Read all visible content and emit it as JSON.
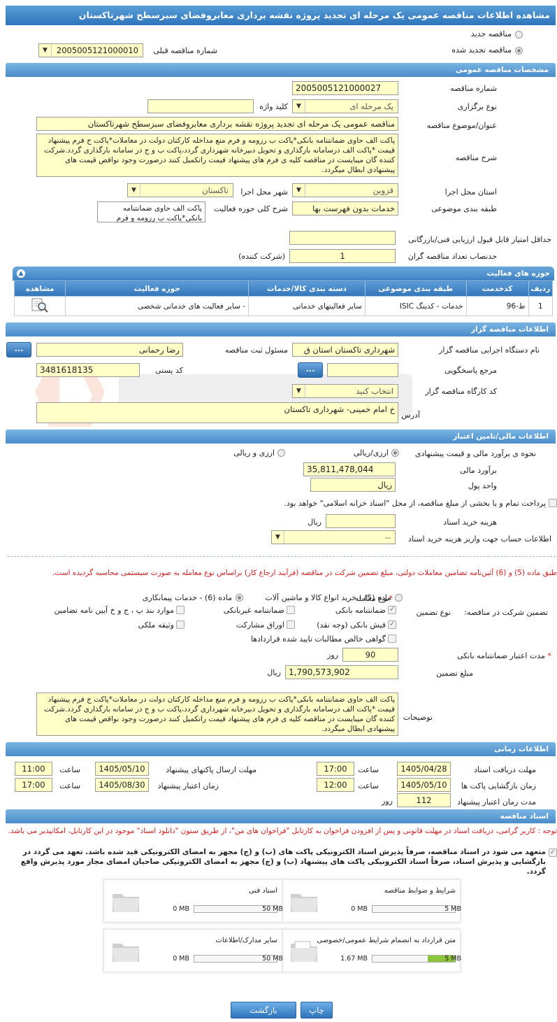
{
  "page_title": "مشاهده اطلاعات مناقصه عمومی یک مرحله ای تجدید پروژه نقشه برداری معابروفضای سبزسطح شهرتاکستان",
  "top": {
    "new_tender": "مناقصه جدید",
    "renewed_tender": "مناقصه تجدید شده",
    "prev_number_label": "شماره مناقصه قبلی",
    "prev_number": "2005005121000010"
  },
  "general": {
    "header": "مشخصات مناقصه عمومی",
    "number_label": "شماره مناقصه",
    "number": "2005005121000027",
    "type_label": "نوع برگزاری",
    "type": "یک مرحله ای",
    "keyword_label": "کلید واژه",
    "keyword": "",
    "subject_label": "عنوان/موضوع مناقصه",
    "subject": "مناقصه عمومی یک مرحله ای  تجدید پروژه نقشه برداری معابروفضای سبزسطح شهرتاکستان",
    "desc_label": "شرح مناقصه",
    "desc": "پاکت الف حاوی ضمانتنامه بانکی*پاکت ب رزومه و فرم منع مداخله کارکنان دولت در معاملات*پاکت ج فرم پیشنهاد  قیمت *پاکت الف درسامانه بارگذاری و تحویل دبیرخانه شهرداری گردد،پاکت ب و ج در سامانه بارگذاری گردد.شرکت کننده گان میبایست در مناقصه کلیه ی فرم های پیشنهاد قیمت راتکمیل کنند درصورت وجود نواقص قیمت های پیشنهادی ابطال میگردد.",
    "province_label": "استان محل اجرا",
    "province": "قزوین",
    "city_label": "شهر محل اجرا",
    "city": "تاکستان",
    "category_label": "طبقه بندی موضوعی",
    "category": "خدمات بدون فهرست بها",
    "activity_label": "شرح کلی حوزه فعالیت",
    "activity": "پاکت الف حاوی ضمانتنامه بانکی*پاکت ب رزومه و فرم",
    "min_score_label": "حداقل امتیاز قابل قبول ارزیابی فنی/بازرگانی",
    "min_score": "",
    "quorum_label": "حدنصاب تعداد مناقصه گران",
    "quorum": "1",
    "quorum_unit": "(شرکت کننده)"
  },
  "activity_grid": {
    "header": "حوزه های فعالیت",
    "columns": [
      "ردیف",
      "کدخدمت",
      "طبقه بندی موضوعی",
      "دسته بندی کالا/خدمات",
      "حوزه فعالیت",
      "مشاهده"
    ],
    "rows": [
      [
        "1",
        "ط-96",
        "خدمات - کدینگ ISIC",
        "سایر فعالیتهای خدماتی",
        "- سایر فعالیت های خدماتی شخصی",
        ""
      ]
    ]
  },
  "organizer": {
    "header": "اطلاعات مناقصه گزار",
    "org_label": "نام دستگاه اجرایی مناقصه گزار",
    "org": "شهرداری تاکستان استان ق",
    "officer_label": "مسئول ثبت مناقصه",
    "officer": "رضا رحمانی",
    "ref_label": "مرجع پاسخگویی",
    "ref": "",
    "postal_label": "کد پستی",
    "postal": "3481618135",
    "workshop_label": "کد کارگاه مناقصه گزار",
    "workshop": "انتخاب کنید",
    "address_label": "آدرس",
    "address": "خ امام خمینی- شهرداری تاکستان",
    "dots": "..."
  },
  "finance": {
    "header": "اطلاعات مالی/تامین اعتبار",
    "method_label": "نحوه ی برآورد مالی و قیمت پیشنهادی",
    "opt_rial": "ارزی/ریالی",
    "opt_both": "ارزی و ریالی",
    "estimate_label": "برآورد مالی",
    "estimate": "35,811,478,044",
    "unit_label": "واحد پول",
    "unit": "ریال",
    "islamic_note": "پرداخت تمام و یا بخشی از مبلغ مناقصه، از محل \"اسناد خزانه اسلامی\" خواهد بود.",
    "doc_cost_label": "هزینه خرید اسناد",
    "doc_cost": "",
    "doc_cost_unit": "ریال",
    "account_label": "اطلاعات حساب جهت واریز هزینه خرید اسناد",
    "account": "--"
  },
  "guarantee": {
    "notice": "طبق ماده (5) و (6) آئین‌نامه تضامین معاملات دولتی، مبلغ تضمین شرکت در مناقصه (فرآیند ارجاع کار) براساس نوع معامله به صورت سیستمی محاسبه گردیده است.",
    "deal_type_label": "نوع معامله",
    "deal_opt5": "ماده (5) - خرید انواع کالا و ماشین آلات",
    "deal_opt6": "ماده (6) - خدمات پیمانکاری",
    "participation_label": "تضمین شرکت در مناقصه:",
    "guarantee_type_label": "نوع تضمین",
    "types": {
      "bank_guarantee": "ضمانتنامه بانکی",
      "nonbank_guarantee": "ضمانتنامه غیربانکی",
      "items_b": "موارد بند پ ، ج و خ آیین نامه تضامین",
      "bank_check": "فیش بانکی (وجه نقد)",
      "bonds": "اوراق مشارکت",
      "property": "وثیقه ملکی",
      "receivables": "گواهی خالص مطالبات تایید شده قراردادها"
    },
    "validity_label": "مدت اعتبار ضمانتنامه بانکی",
    "validity": "90",
    "validity_unit": "روز",
    "amount_label": "مبلغ تضمین",
    "amount": "1,790,573,902",
    "amount_unit": "ریال",
    "notes_label": "توضیحات",
    "notes": "پاکت الف حاوی ضمانتنامه بانکی*پاکت ب رزومه و فرم منع مداخله کارکنان دولت در معاملات*پاکت ج فرم پیشنهاد  قیمت *پاکت الف درسامانه بارگذاری و تحویل دبیرخانه شهرداری گردد،پاکت ب و ج در سامانه بارگذاری گردد.شرکت کننده گان میبایست در مناقصه کلیه ی فرم های پیشنهاد قیمت راتکمیل کنند درصورت وجود نواقص قیمت های پیشنهادی ابطال میگردد."
  },
  "timing": {
    "header": "اطلاعات زمانی",
    "receive_label": "مهلت دریافت اسناد",
    "receive_date": "1405/04/28",
    "receive_time": "17:00",
    "send_label": "مهلت ارسال پاکتهای پیشنهاد",
    "send_date": "1405/05/10",
    "send_time": "11:00",
    "open_label": "زمان بازگشایی پاکت ها",
    "open_date": "1405/05/10",
    "open_time": "12:00",
    "valid_label": "زمان اعتبار پیشنهاد",
    "valid_date": "1405/08/30",
    "valid_time": "17:00",
    "time_label": "ساعت",
    "duration_label": "مدت زمان اعتبار پیشنهاد",
    "duration": "112",
    "duration_unit": "روز"
  },
  "docs": {
    "header": "اسناد مناقصه",
    "notice": "توجه : کاربر گرامی، دریافت اسناد در مهلت قانونی و پس از افزودن فراخوان به کارتابل \"فراخوان های من\"، از طریق ستون \"دانلود اسناد\" موجود در این کارتابل، امکانپذیر می باشد.",
    "commit": "متعهد می شود در اسناد مناقصه، صرفاً پذیرش اسناد الکترونیکی پاکت های (ب) و (ج) مجهز به امضای الکترونیکی قید شده باشد. تعهد می گردد در بازگشایی و پذیرش اسناد، صرفاً اسناد الکترونیکی پاکت های پیشنهاد (ب) و (ج) مجهز به امضای الکترونیکی صاحبان امضای مجاز مورد پذیرش واقع گردد.",
    "files": [
      {
        "name": "شرایط و ضوابط مناقصه",
        "current": "0 MB",
        "max": "5 MB",
        "fill": 0
      },
      {
        "name": "اسناد فنی",
        "current": "0 MB",
        "max": "50 MB",
        "fill": 0
      },
      {
        "name": "متن قرارداد به انضمام شرایط عمومی/خصوصی",
        "current": "1.67 MB",
        "max": "5 MB",
        "fill": 0.33
      },
      {
        "name": "سایر مدارک/اطلاعات",
        "current": "0 MB",
        "max": "50 MB",
        "fill": 0
      }
    ]
  },
  "buttons": {
    "print": "چاپ",
    "back": "بازگشت"
  },
  "colors": {
    "section": "#4a8cc9",
    "field": "#ffffc8",
    "notice_red": "#d21e1e",
    "progress": "#8cc43c"
  }
}
